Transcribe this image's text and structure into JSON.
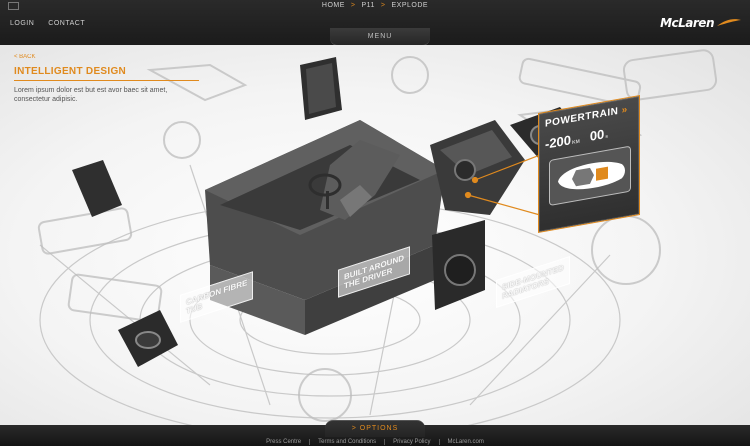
{
  "breadcrumb": {
    "items": [
      "HOME",
      "P11",
      "EXPLODE"
    ]
  },
  "top_links": {
    "login": "LOGIN",
    "contact": "CONTACT"
  },
  "brand": {
    "logo": "McLaren"
  },
  "menu": {
    "label": "MENU"
  },
  "info_panel": {
    "back": "< BACK",
    "title": "INTELLIGENT DESIGN",
    "body": "Lorem ipsum dolor est but est avor baec sit amet, consectetur adipisic."
  },
  "powertrain": {
    "title": "POWERTRAIN",
    "chevrons": "»",
    "speed_value": "-200",
    "speed_unit": "KM",
    "time_value": "00",
    "time_unit": "s"
  },
  "labels": {
    "carbon_fibre": "CARBON FIBRE\nTUB",
    "built_around": "BUILT AROUND\nTHE DRIVER",
    "side_mounted": "SIDE-MOUNTED\nRADIATORS"
  },
  "options": {
    "label": "> OPTIONS"
  },
  "footer": {
    "links": [
      "Press Centre",
      "Terms and Conditions",
      "Privacy Policy",
      "McLaren.com"
    ]
  },
  "colors": {
    "accent": "#e08a1e",
    "chrome": "#1f1f1f"
  }
}
